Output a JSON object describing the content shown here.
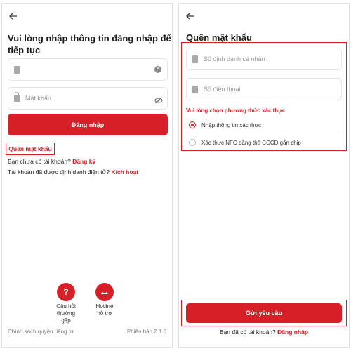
{
  "login": {
    "title": "Vui lòng nhập thông tin đăng nhập để tiếp tục",
    "title_line1": "Vui lòng nhập thông tin đăng nhập để",
    "title_line2": "tiếp tục",
    "id_field_value": "",
    "password_placeholder": "Mật khẩu",
    "login_button": "Đăng nhập",
    "forgot_password": "Quên mật khẩu",
    "no_account_text": "Bạn chưa có tài khoản?",
    "register_link": "Đăng ký",
    "activate_text": "Tài khoản đã được định danh điện tử?",
    "activate_link": "Kích hoạt",
    "support": [
      {
        "label_line1": "Câu hỏi",
        "label_line2": "thường gặp",
        "icon": "question-icon"
      },
      {
        "label_line1": "Hotline",
        "label_line2": "hỗ trợ",
        "icon": "hotline-icon"
      }
    ],
    "privacy_policy": "Chính sách quyền riêng tư",
    "version": "Phiên bản 2.1.0"
  },
  "forgot": {
    "title": "Quên mật khẩu",
    "id_placeholder": "Số định danh cá nhân",
    "phone_placeholder": "Số điện thoại",
    "verify_label": "Vui lòng chọn phương thức xác thực",
    "options": [
      {
        "label": "Nhập thông tin xác thực",
        "selected": true
      },
      {
        "label": "Xác thực NFC bằng thẻ CCCD gắn chip",
        "selected": false
      }
    ],
    "submit_button": "Gửi yêu cầu",
    "have_account_text": "Bạn đã có tài khoản?",
    "login_link": "Đăng nhập"
  },
  "colors": {
    "accent": "#d61f26",
    "highlight_border": "#d61f26"
  }
}
